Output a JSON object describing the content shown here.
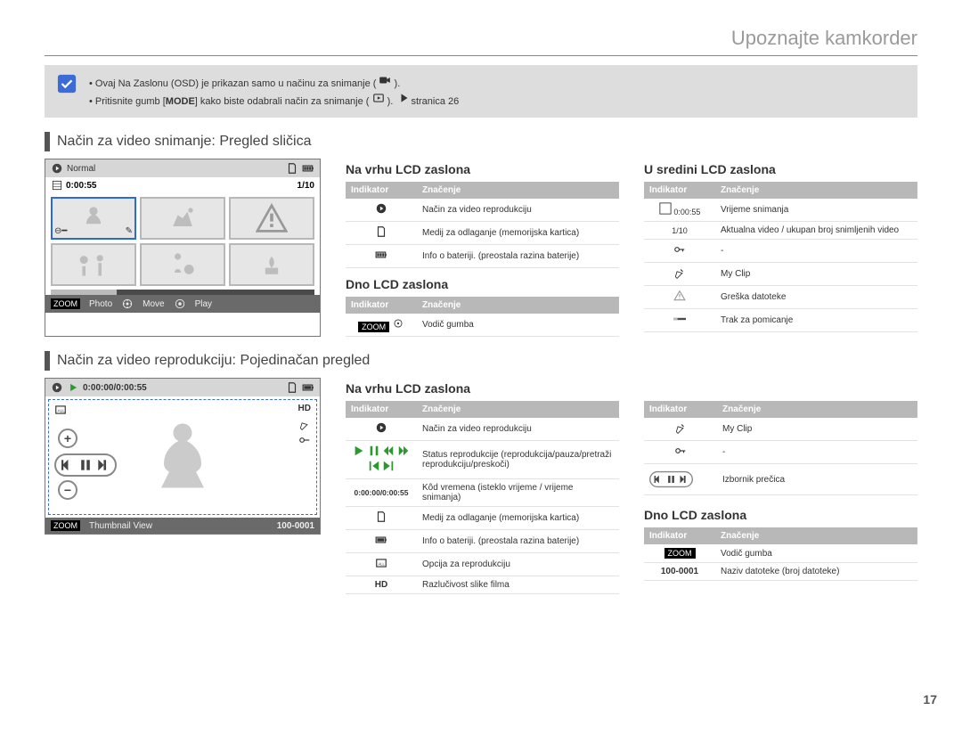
{
  "page": {
    "title": "Upoznajte kamkorder",
    "number": "17"
  },
  "note": {
    "line1_pre": "Ovaj",
    "line1_mid": "Na Zaslonu (OSD) je prikazan samo u načinu za snimanje (",
    "line1_post": ").",
    "line2_pre": "Pritisnite gumb [",
    "line2_mode": "MODE",
    "line2_mid": "] kako biste odabrali način za snimanje (",
    "line2_post": ").",
    "line2_ref": "stranica 26"
  },
  "section1": {
    "heading": "Način za video snimanje: Pregled sličica",
    "lcd": {
      "mode_label": "Normal",
      "time": "0:00:55",
      "counter": "1/10",
      "bottom_zoom": "ZOOM",
      "bottom_photo": "Photo",
      "bottom_move": "Move",
      "bottom_play": "Play"
    },
    "top": {
      "heading": "Na vrhu LCD zaslona",
      "th_ind": "Indikator",
      "th_mean": "Značenje",
      "rows": [
        {
          "mean": "Način za video reprodukciju"
        },
        {
          "mean": "Medij za odlaganje (memorijska kartica)"
        },
        {
          "mean": "Info o bateriji. (preostala razina baterije)"
        }
      ]
    },
    "bottom": {
      "heading": "Dno LCD zaslona",
      "th_ind": "Indikator",
      "th_mean": "Značenje",
      "rows": [
        {
          "ind_chip": "ZOOM",
          "mean": "Vodič gumba"
        }
      ]
    },
    "center": {
      "heading": "U sredini LCD zaslona",
      "th_ind": "Indikator",
      "th_mean": "Značenje",
      "rows": [
        {
          "ind": "0:00:55",
          "mean": "Vrijeme snimanja"
        },
        {
          "ind": "1/10",
          "mean": "Aktualna video / ukupan broj snimljenih video"
        },
        {
          "mean": "-"
        },
        {
          "mean": "My Clip"
        },
        {
          "mean": "Greška datoteke"
        },
        {
          "mean": "Trak za pomicanje"
        }
      ]
    }
  },
  "section2": {
    "heading": "Način za video reprodukciju: Pojedinačan pregled",
    "lcd": {
      "time": "0:00:00/0:00:55",
      "bottom_zoom": "ZOOM",
      "bottom_thumb": "Thumbnail View",
      "bottom_file": "100-0001"
    },
    "top": {
      "heading": "Na vrhu LCD zaslona",
      "th_ind": "Indikator",
      "th_mean": "Značenje",
      "rows": [
        {
          "mean": "Način za video reprodukciju"
        },
        {
          "mean": "Status reprodukcije (reprodukcija/pauza/pretraži reprodukciju/preskoči)"
        },
        {
          "ind": "0:00:00/0:00:55",
          "mean": "Kôd vremena (isteklo vrijeme / vrijeme snimanja)"
        },
        {
          "mean": "Medij za odlaganje (memorijska kartica)"
        },
        {
          "mean": "Info o bateriji. (preostala razina baterije)"
        },
        {
          "mean": "Opcija za reprodukciju"
        },
        {
          "ind": "HD",
          "mean": "Razlučivost slike filma"
        }
      ]
    },
    "right_top": {
      "th_ind": "Indikator",
      "th_mean": "Značenje",
      "rows": [
        {
          "mean": "My Clip"
        },
        {
          "mean": "-"
        },
        {
          "mean": "Izbornik prečica"
        }
      ]
    },
    "right_bottom": {
      "heading": "Dno LCD zaslona",
      "th_ind": "Indikator",
      "th_mean": "Značenje",
      "rows": [
        {
          "ind_chip": "ZOOM",
          "mean": "Vodič gumba"
        },
        {
          "ind": "100-0001",
          "mean": "Naziv datoteke (broj datoteke)"
        }
      ]
    }
  }
}
